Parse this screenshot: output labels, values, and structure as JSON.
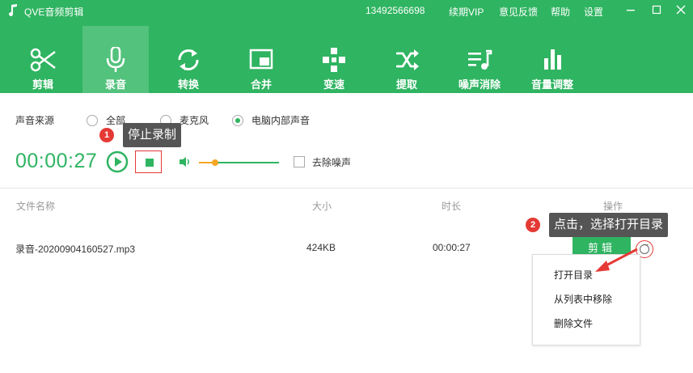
{
  "app": {
    "title": "QVE音频剪辑"
  },
  "header": {
    "phone": "13492566698",
    "renew": "续期VIP",
    "feedback": "意见反馈",
    "help": "帮助",
    "settings": "设置"
  },
  "toolbar": {
    "items": [
      {
        "label": "剪辑",
        "icon": "scissors-icon"
      },
      {
        "label": "录音",
        "icon": "microphone-icon",
        "active": true
      },
      {
        "label": "转换",
        "icon": "convert-icon"
      },
      {
        "label": "合并",
        "icon": "merge-icon"
      },
      {
        "label": "变速",
        "icon": "speed-icon"
      },
      {
        "label": "提取",
        "icon": "extract-icon"
      },
      {
        "label": "噪声消除",
        "icon": "noise-icon"
      },
      {
        "label": "音量调整",
        "icon": "volume-bars-icon"
      }
    ]
  },
  "record": {
    "source_label": "声音来源",
    "options": [
      {
        "label": "全部",
        "checked": false
      },
      {
        "label": "麦克风",
        "checked": false
      },
      {
        "label": "电脑内部声音",
        "checked": true
      }
    ],
    "timer": "00:00:27",
    "denoise_label": "去除噪声"
  },
  "annotations": {
    "step1_num": "1",
    "step1_text": "停止录制",
    "step2_num": "2",
    "step2_text": "点击，选择打开目录"
  },
  "table": {
    "headers": {
      "name": "文件名称",
      "size": "大小",
      "duration": "时长",
      "action": "操作"
    },
    "rows": [
      {
        "name": "录音-20200904160527.mp3",
        "size": "424KB",
        "duration": "00:00:27",
        "edit": "剪辑"
      }
    ]
  },
  "menu": {
    "items": [
      "打开目录",
      "从列表中移除",
      "删除文件"
    ]
  },
  "colors": {
    "primary": "#2fb461",
    "active_tab": "#53c27c",
    "accent_red": "#e53935",
    "slider_orange": "#f5a623"
  }
}
